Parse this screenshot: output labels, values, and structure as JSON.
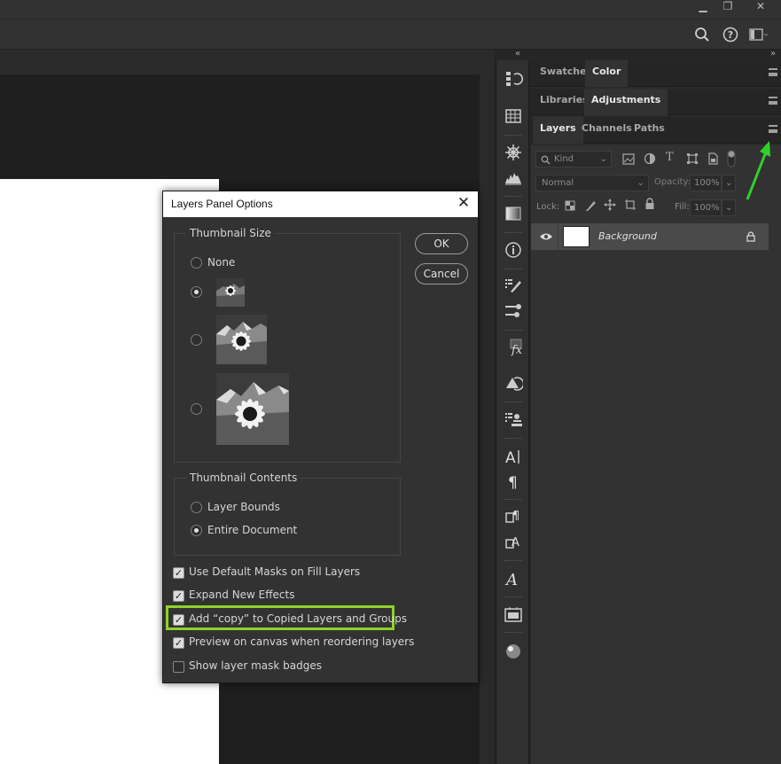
{
  "window": {
    "minimize_glyph": "▁",
    "restore_glyph": "❐",
    "close_glyph": "✕"
  },
  "options_bar": {
    "search_icon": "search-icon",
    "help_glyph": "?",
    "workspace_icon": "workspace-icon"
  },
  "panels": {
    "row1": {
      "tabs": [
        "Swatches",
        "Color"
      ],
      "active": "Color"
    },
    "row2": {
      "tabs": [
        "Libraries",
        "Adjustments"
      ],
      "active": "Adjustments"
    },
    "row3": {
      "tabs": [
        "Layers",
        "Channels",
        "Paths"
      ],
      "active": "Layers"
    },
    "kind_label": "Kind",
    "blend_mode": "Normal",
    "opacity_label": "Opacity:",
    "opacity_value": "100%",
    "lock_label": "Lock:",
    "fill_label": "Fill:",
    "fill_value": "100%",
    "layer_name": "Background"
  },
  "dialog": {
    "title": "Layers Panel Options",
    "close_glyph": "✕",
    "thumbnail_size_label": "Thumbnail Size",
    "thumbnail_sizes": [
      {
        "label": "None",
        "selected": false
      },
      {
        "label": "",
        "selected": true
      },
      {
        "label": "",
        "selected": false
      },
      {
        "label": "",
        "selected": false
      }
    ],
    "thumbnail_contents_label": "Thumbnail Contents",
    "thumbnail_contents": [
      {
        "label": "Layer Bounds",
        "selected": false
      },
      {
        "label": "Entire Document",
        "selected": true
      }
    ],
    "ok_label": "OK",
    "cancel_label": "Cancel",
    "checkboxes": [
      {
        "label": "Use Default Masks on Fill Layers",
        "checked": true
      },
      {
        "label": "Expand New Effects",
        "checked": true
      },
      {
        "label": "Add “copy” to Copied Layers and Groups",
        "checked": true,
        "highlighted": true
      },
      {
        "label": "Preview on canvas when reordering layers",
        "checked": true
      },
      {
        "label": "Show layer mask badges",
        "checked": false
      }
    ],
    "check_glyph": "✓"
  },
  "colors": {
    "highlight_box": "#8fd12b",
    "annotation_arrow": "#2fd12b",
    "dialog_bg": "#323232",
    "panel_bg": "#323232"
  }
}
